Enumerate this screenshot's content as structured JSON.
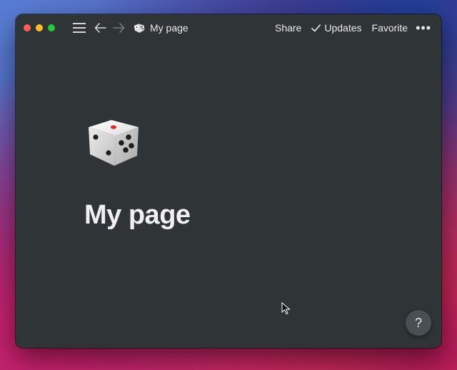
{
  "titlebar": {
    "breadcrumb_label": "My page",
    "share_label": "Share",
    "updates_label": "Updates",
    "favorite_label": "Favorite",
    "more_label": "•••"
  },
  "page": {
    "icon": "dice-icon",
    "title": "My page"
  },
  "help": {
    "label": "?"
  },
  "colors": {
    "window_bg": "#2f3437",
    "text": "#e6e6e6"
  }
}
